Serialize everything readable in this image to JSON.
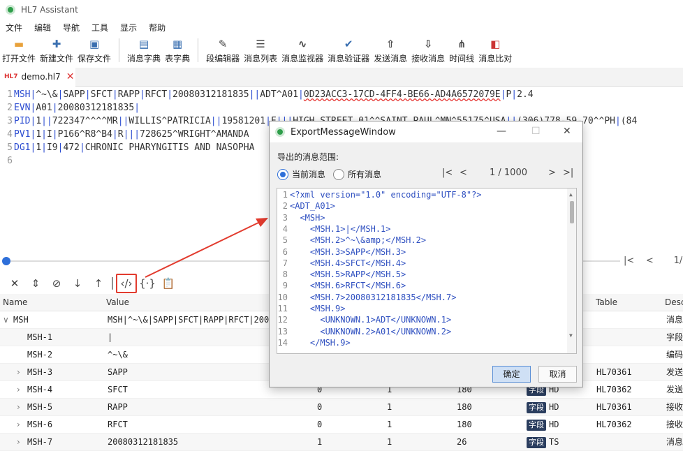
{
  "app": {
    "title": "HL7 Assistant"
  },
  "menu": [
    "文件",
    "编辑",
    "导航",
    "工具",
    "显示",
    "帮助"
  ],
  "toolbar": [
    {
      "label": "打开文件",
      "icon": "open-folder-icon"
    },
    {
      "label": "新建文件",
      "icon": "new-file-icon"
    },
    {
      "label": "保存文件",
      "icon": "save-icon"
    },
    {
      "label": "消息字典",
      "icon": "message-dict-icon"
    },
    {
      "label": "表字典",
      "icon": "table-dict-icon"
    },
    {
      "label": "段编辑器",
      "icon": "segment-editor-icon"
    },
    {
      "label": "消息列表",
      "icon": "message-list-icon"
    },
    {
      "label": "消息监视器",
      "icon": "monitor-icon"
    },
    {
      "label": "消息验证器",
      "icon": "validator-icon"
    },
    {
      "label": "发送消息",
      "icon": "send-icon"
    },
    {
      "label": "接收消息",
      "icon": "receive-icon"
    },
    {
      "label": "时间线",
      "icon": "timeline-icon"
    },
    {
      "label": "消息比对",
      "icon": "compare-icon"
    }
  ],
  "tab": {
    "badge": "HL7",
    "name": "demo.hl7"
  },
  "editor": {
    "lines": [
      {
        "n": "1",
        "seg": "MSH",
        "rest": "|^~\\&|SAPP|SFCT|RAPP|RFCT|20080312181835||ADT^A01|",
        "wavy": "0D23ACC3-17CD-4FF4-BE66-AD4A6572079E",
        "tail": "|P|2.4"
      },
      {
        "n": "2",
        "seg": "EVN",
        "rest": "|A01|20080312181835|",
        "wavy": "",
        "tail": ""
      },
      {
        "n": "3",
        "seg": "PID",
        "rest": "|1||722347^^^^MR||WILLIS^PATRICIA||19581201|F|||HIGH STREET 01^^SAINT PAUL^MN^55175^USA||(306)778-59-70^^PH|(84",
        "wavy": "",
        "tail": ""
      },
      {
        "n": "4",
        "seg": "PV1",
        "rest": "|1|I|P166^R8^B4|R|||728625^WRIGHT^AMANDA",
        "wavy": "",
        "tail": ""
      },
      {
        "n": "5",
        "seg": "DG1",
        "rest": "|1|I9|472|CHRONIC PHARYNGITIS AND NASOPHA",
        "wavy": "",
        "tail": ""
      },
      {
        "n": "6",
        "seg": "",
        "rest": "",
        "wavy": "",
        "tail": ""
      }
    ]
  },
  "bottom_pager": {
    "first": "|<",
    "prev": "<",
    "text": "1/"
  },
  "grid": {
    "headers": {
      "name": "Name",
      "value": "Value",
      "table": "Table",
      "desc": "Desc"
    },
    "rows": [
      {
        "expander": "∨",
        "name": "MSH",
        "value": "MSH|^~\\&|SAPP|SFCT|RAPP|RFCT|200",
        "c1": "",
        "c2": "",
        "c3": "",
        "type": "",
        "dtype": "",
        "table": "",
        "desc": "消息"
      },
      {
        "expander": "",
        "name": "MSH-1",
        "value": "|",
        "c1": "",
        "c2": "",
        "c3": "",
        "type": "",
        "dtype": "",
        "table": "",
        "desc": "字段"
      },
      {
        "expander": "",
        "name": "MSH-2",
        "value": "^~\\&",
        "c1": "",
        "c2": "",
        "c3": "",
        "type": "",
        "dtype": "",
        "table": "",
        "desc": "编码"
      },
      {
        "expander": "›",
        "name": "MSH-3",
        "value": "SAPP",
        "c1": "",
        "c2": "",
        "c3": "",
        "type": "",
        "dtype": "",
        "table": "HL70361",
        "desc": "发送"
      },
      {
        "expander": "›",
        "name": "MSH-4",
        "value": "SFCT",
        "c1": "0",
        "c2": "1",
        "c3": "180",
        "type": "字段",
        "dtype": "HD",
        "table": "HL70362",
        "desc": "发送"
      },
      {
        "expander": "›",
        "name": "MSH-5",
        "value": "RAPP",
        "c1": "0",
        "c2": "1",
        "c3": "180",
        "type": "字段",
        "dtype": "HD",
        "table": "HL70361",
        "desc": "接收"
      },
      {
        "expander": "›",
        "name": "MSH-6",
        "value": "RFCT",
        "c1": "0",
        "c2": "1",
        "c3": "180",
        "type": "字段",
        "dtype": "HD",
        "table": "HL70362",
        "desc": "接收"
      },
      {
        "expander": "›",
        "name": "MSH-7",
        "value": "20080312181835",
        "c1": "1",
        "c2": "1",
        "c3": "26",
        "type": "字段",
        "dtype": "TS",
        "table": "",
        "desc": "消息"
      }
    ]
  },
  "dialog": {
    "title": "ExportMessageWindow",
    "range_label": "导出的消息范围:",
    "radio_current": "当前消息",
    "radio_all": "所有消息",
    "pager": {
      "first": "|<",
      "prev": "<",
      "text": "1 / 1000",
      "next": ">",
      "last": ">|"
    },
    "xml": [
      {
        "n": "1",
        "indent": "",
        "text": "<?xml version=\"1.0\" encoding=\"UTF-8\"?>"
      },
      {
        "n": "2",
        "indent": "",
        "text": "<ADT_A01>"
      },
      {
        "n": "3",
        "indent": "  ",
        "text": "<MSH>"
      },
      {
        "n": "4",
        "indent": "    ",
        "text": "<MSH.1>|</MSH.1>"
      },
      {
        "n": "5",
        "indent": "    ",
        "text": "<MSH.2>^~\\&amp;</MSH.2>"
      },
      {
        "n": "6",
        "indent": "    ",
        "text": "<MSH.3>SAPP</MSH.3>"
      },
      {
        "n": "7",
        "indent": "    ",
        "text": "<MSH.4>SFCT</MSH.4>"
      },
      {
        "n": "8",
        "indent": "    ",
        "text": "<MSH.5>RAPP</MSH.5>"
      },
      {
        "n": "9",
        "indent": "    ",
        "text": "<MSH.6>RFCT</MSH.6>"
      },
      {
        "n": "10",
        "indent": "    ",
        "text": "<MSH.7>20080312181835</MSH.7>"
      },
      {
        "n": "11",
        "indent": "    ",
        "text": "<MSH.9>"
      },
      {
        "n": "12",
        "indent": "      ",
        "text": "<UNKNOWN.1>ADT</UNKNOWN.1>"
      },
      {
        "n": "13",
        "indent": "      ",
        "text": "<UNKNOWN.2>A01</UNKNOWN.2>"
      },
      {
        "n": "14",
        "indent": "    ",
        "text": "</MSH.9>"
      }
    ],
    "ok": "确定",
    "cancel": "取消"
  },
  "colors": {
    "accent": "#2e6fd9",
    "highlight_box": "#e23b2e",
    "type_badge": "#2b3e5f"
  }
}
